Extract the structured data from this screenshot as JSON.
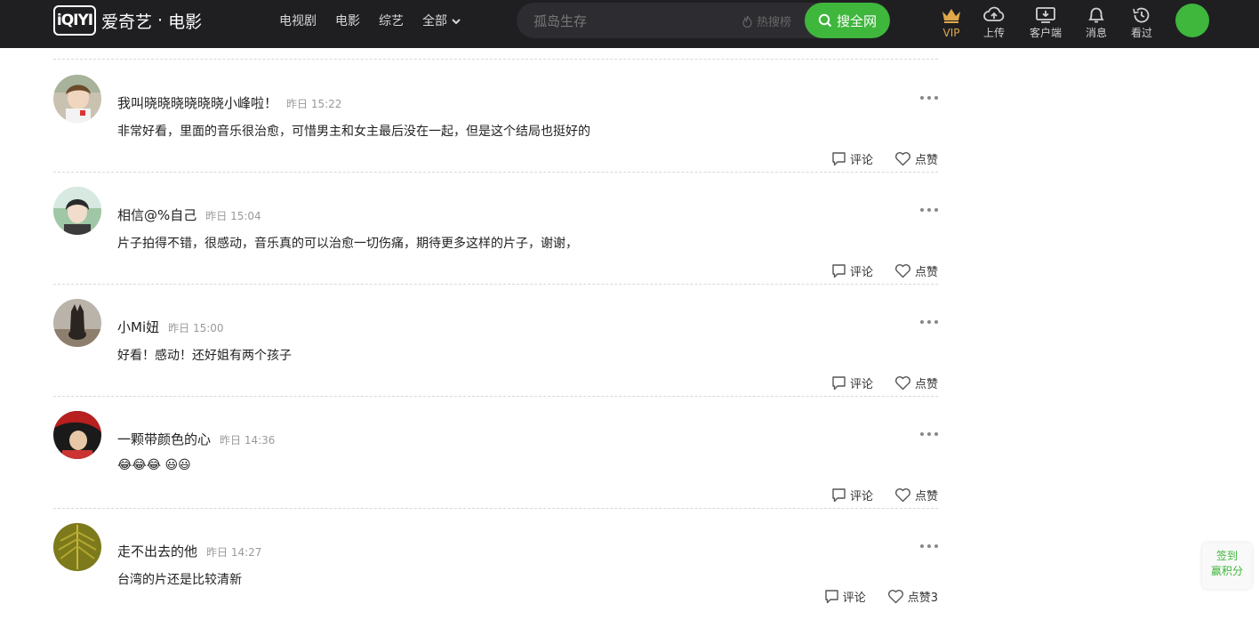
{
  "header": {
    "logo_mark": "iQIYI",
    "logo_brand": "爱奇艺",
    "logo_dot": "·",
    "logo_section": "电影",
    "nav": [
      {
        "label": "电视剧"
      },
      {
        "label": "电影"
      },
      {
        "label": "综艺"
      },
      {
        "label": "全部"
      }
    ],
    "search": {
      "placeholder": "孤岛生存",
      "hot_label": "热搜榜",
      "button_label": "搜全网"
    },
    "tools": [
      {
        "label": "VIP",
        "icon": "crown-icon"
      },
      {
        "label": "上传",
        "icon": "upload-icon"
      },
      {
        "label": "客户端",
        "icon": "download-client-icon"
      },
      {
        "label": "消息",
        "icon": "bell-icon"
      },
      {
        "label": "看过",
        "icon": "history-icon"
      }
    ],
    "accent_color": "#3fb63c",
    "vip_color": "#e0a84b"
  },
  "comments": [
    {
      "user": "我叫晓晓晓晓晓晓小峰啦！",
      "time": "昨日 15:22",
      "text": "非常好看，里面的音乐很治愈，可惜男主和女主最后没在一起，但是这个结局也挺好的",
      "reply_label": "评论",
      "like_label": "点赞"
    },
    {
      "user": "相信@%自己",
      "time": "昨日 15:04",
      "text": "片子拍得不错，很感动，音乐真的可以治愈一切伤痛，期待更多这样的片子，谢谢，",
      "reply_label": "评论",
      "like_label": "点赞"
    },
    {
      "user": "小Mi妞",
      "time": "昨日 15:00",
      "text": "好看！感动！还好姐有两个孩子",
      "reply_label": "评论",
      "like_label": "点赞"
    },
    {
      "user": "一颗带颜色的心",
      "time": "昨日 14:36",
      "text": "😂😂😂 😃😃",
      "reply_label": "评论",
      "like_label": "点赞"
    },
    {
      "user": "走不出去的他",
      "time": "昨日 14:27",
      "text": "台湾的片还是比较清新",
      "reply_label": "评论",
      "like_label": "点赞3"
    }
  ],
  "sign_in": {
    "line1": "签到",
    "line2": "赢积分"
  }
}
